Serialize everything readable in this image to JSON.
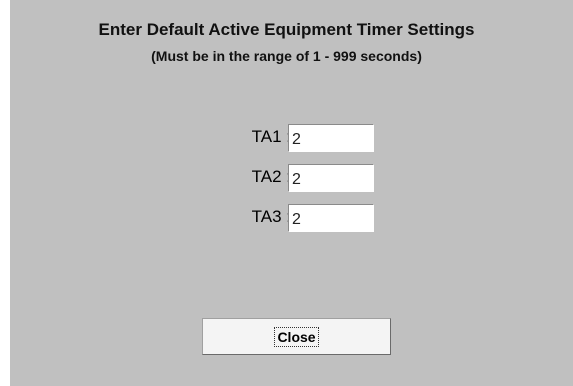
{
  "dialog": {
    "title": "Enter Default Active Equipment Timer Settings",
    "subtitle": "(Must be in the range of 1 - 999 seconds)"
  },
  "fields": [
    {
      "label": "TA1 :",
      "value": "2"
    },
    {
      "label": "TA2 :",
      "value": "2"
    },
    {
      "label": "TA3 :",
      "value": "2"
    }
  ],
  "buttons": {
    "close_label": "Close"
  },
  "colors": {
    "dialog_background": "#c0c0c0",
    "input_background": "#ffffff",
    "button_background": "#f4f4f4"
  }
}
